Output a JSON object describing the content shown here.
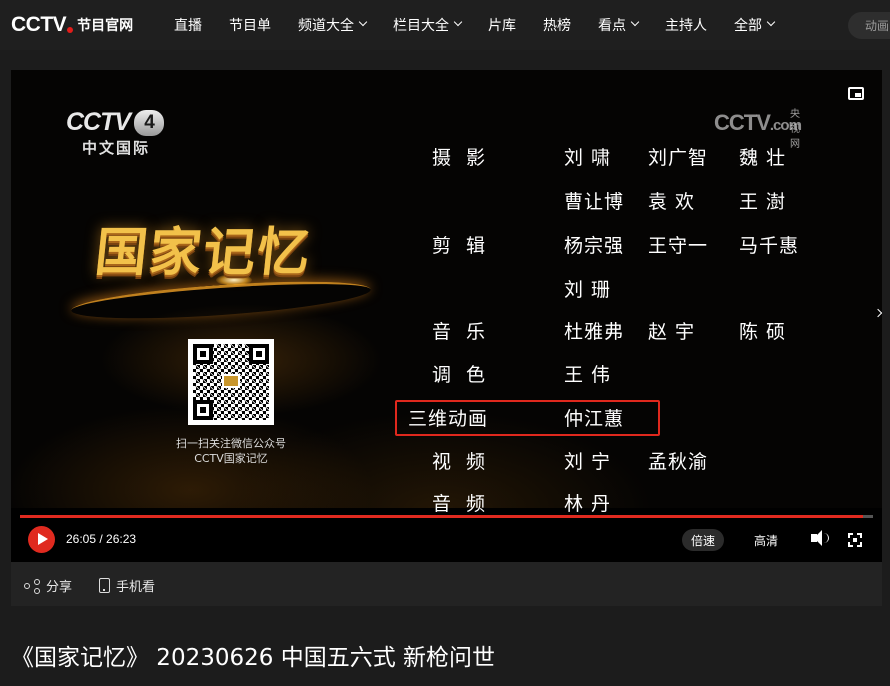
{
  "site": {
    "logo_text": "CCTV",
    "logo_subtitle": "节目官网"
  },
  "nav": {
    "items": [
      {
        "label": "直播",
        "dropdown": false
      },
      {
        "label": "节目单",
        "dropdown": false
      },
      {
        "label": "频道大全",
        "dropdown": true
      },
      {
        "label": "栏目大全",
        "dropdown": true
      },
      {
        "label": "片库",
        "dropdown": false
      },
      {
        "label": "热榜",
        "dropdown": false
      },
      {
        "label": "看点",
        "dropdown": true
      },
      {
        "label": "主持人",
        "dropdown": false
      },
      {
        "label": "全部",
        "dropdown": true
      }
    ],
    "search_placeholder": "动画"
  },
  "video": {
    "channel_logo": "CCTV",
    "channel_number": "4",
    "channel_name": "中文国际",
    "watermark": "CCTV",
    "watermark_com": ".com",
    "watermark_cn": "央视网",
    "program_art_title": "国家记忆",
    "qr_caption_line1": "扫一扫关注微信公众号",
    "qr_caption_line2": "CCTV国家记忆",
    "credits": [
      {
        "role": "摄影",
        "names": [
          "刘 啸",
          "刘广智",
          "魏 壮"
        ]
      },
      {
        "role": "",
        "names": [
          "曹让博",
          "袁 欢",
          "王 澍"
        ]
      },
      {
        "role": "剪辑",
        "names": [
          "杨宗强",
          "王守一",
          "马千惠"
        ]
      },
      {
        "role": "",
        "names": [
          "刘 珊"
        ]
      },
      {
        "role": "音乐",
        "names": [
          "杜雅弗",
          "赵 宇",
          "陈 硕"
        ]
      },
      {
        "role": "调色",
        "names": [
          "王 伟"
        ]
      },
      {
        "role": "三维动画",
        "names": [
          "仲江蕙"
        ]
      },
      {
        "role": "视频",
        "names": [
          "刘 宁",
          "孟秋渝"
        ]
      },
      {
        "role": "音频",
        "names": [
          "林 丹"
        ]
      }
    ],
    "highlight_color": "#e0281d"
  },
  "player": {
    "current_time": "26:05",
    "total_time": "26:23",
    "time_display": "26:05 / 26:23",
    "progress": 0.9886,
    "speed_label": "倍速",
    "quality_label": "高清",
    "accent_color": "#e02a1f"
  },
  "actions": {
    "share_label": "分享",
    "mobile_label": "手机看"
  },
  "page_title": "《国家记忆》 20230626 中国五六式 新枪问世"
}
